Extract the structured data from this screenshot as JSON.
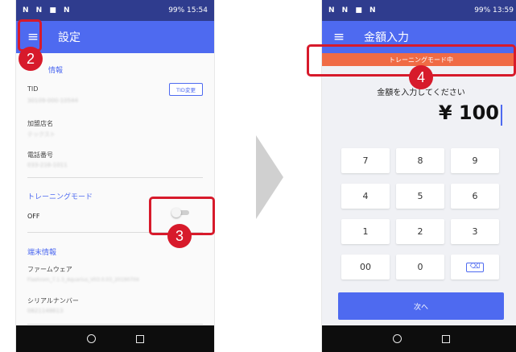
{
  "left_phone": {
    "status_bar": {
      "left_icons": "N N ■ N",
      "right_text": "99% 15:54"
    },
    "app_bar": {
      "title": "設定"
    },
    "sections": {
      "store_info_title": "情報",
      "tid_label": "TID",
      "tid_value": "30109-000-10544",
      "tid_change_button": "TID変更",
      "merchant_label": "加盟店名",
      "merchant_value": "テックスト",
      "phone_label": "電話番号",
      "phone_value": "033-216-1011",
      "training_title": "トレーニングモード",
      "training_state": "OFF",
      "device_title": "端末情報",
      "firmware_label": "ファームウェア",
      "firmware_value": "Flashrom_7.1.3_Aquarius_V03.0.03_20190704",
      "serial_label": "シリアルナンバー",
      "serial_value": "0821148613"
    }
  },
  "right_phone": {
    "status_bar": {
      "left_icons": "N N ■ N",
      "right_text": "99% 13:59"
    },
    "app_bar": {
      "title": "金額入力"
    },
    "training_banner": "トレーニングモード中",
    "prompt": "金額を入力してください",
    "amount": "¥ 100",
    "keys": [
      "7",
      "8",
      "9",
      "4",
      "5",
      "6",
      "1",
      "2",
      "3",
      "00",
      "0",
      "⌫"
    ],
    "next_button": "次へ"
  },
  "annotations": {
    "menu_step": "2",
    "toggle_step": "3",
    "banner_step": "4"
  },
  "colors": {
    "primary": "#4e6af0",
    "statusbar": "#2f3c8e",
    "banner": "#f06b45",
    "highlight": "#d71a2b"
  }
}
